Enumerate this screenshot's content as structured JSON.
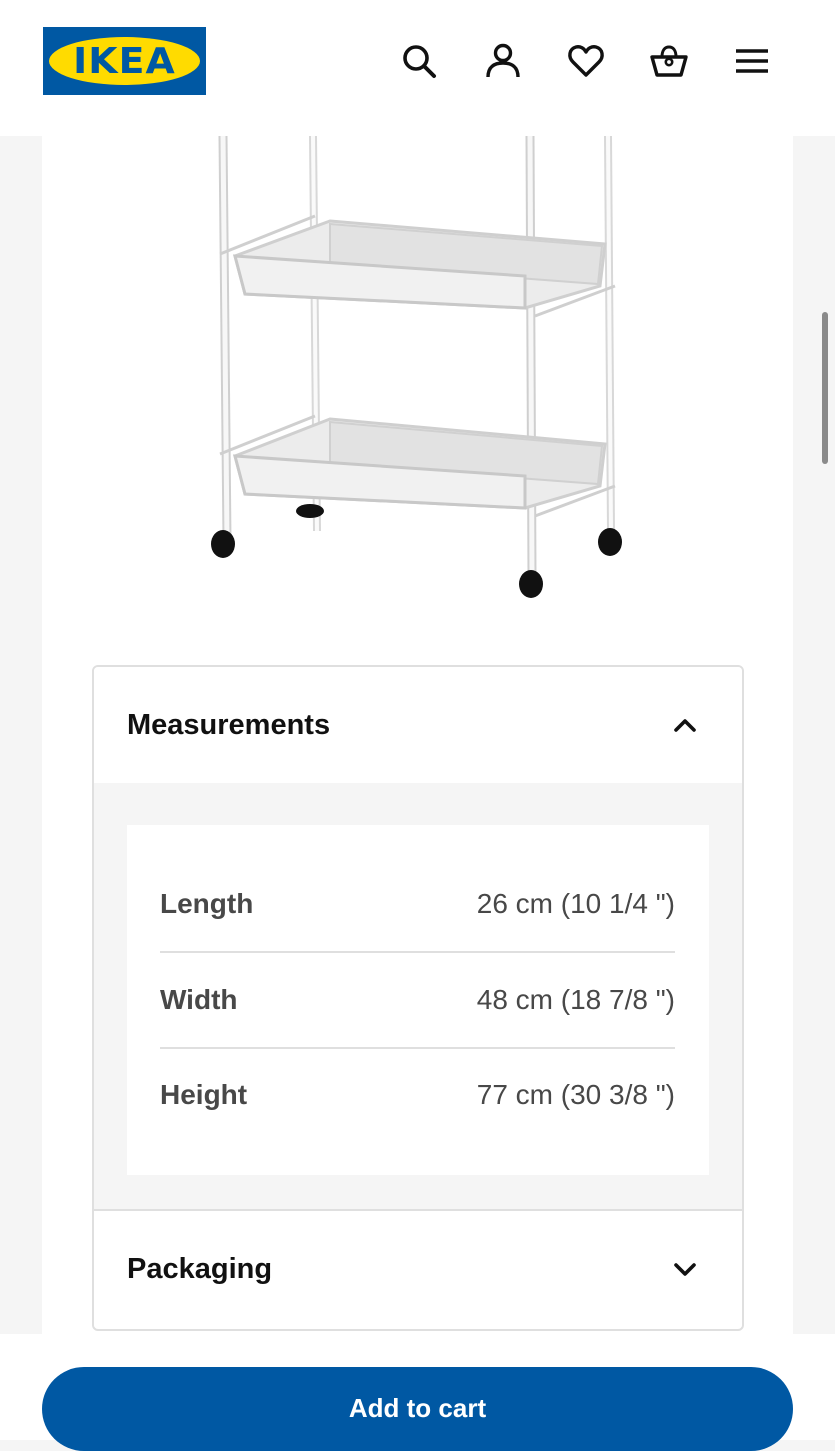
{
  "header": {
    "logo_text": "IKEA",
    "icons": [
      "search-icon",
      "account-icon",
      "heart-icon",
      "cart-icon",
      "menu-icon"
    ]
  },
  "product_image": {
    "alt_icon": "product-image"
  },
  "measurements": {
    "title": "Measurements",
    "expanded": true,
    "rows": [
      {
        "label": "Length",
        "value": "26 cm (10 1/4 \")"
      },
      {
        "label": "Width",
        "value": "48 cm (18 7/8 \")"
      },
      {
        "label": "Height",
        "value": "77 cm (30 3/8 \")"
      }
    ]
  },
  "packaging": {
    "title": "Packaging",
    "expanded": false
  },
  "add_to_cart": {
    "label": "Add to cart"
  },
  "colors": {
    "brand_blue": "#0058a3",
    "brand_yellow": "#ffdb00",
    "divider": "#dfdfdf",
    "text_secondary": "#484848"
  }
}
